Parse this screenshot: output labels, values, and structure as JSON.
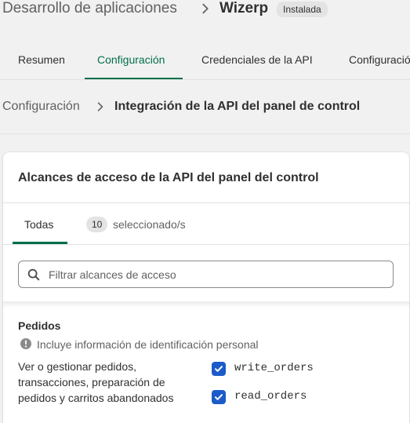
{
  "header": {
    "section": "Desarrollo de aplicaciones",
    "app_name": "Wizerp",
    "status_badge": "Instalada"
  },
  "tabs": [
    {
      "label": "Resumen",
      "active": false
    },
    {
      "label": "Configuración",
      "active": true
    },
    {
      "label": "Credenciales de la API",
      "active": false
    },
    {
      "label": "Configuración",
      "active": false
    }
  ],
  "sub_breadcrumb": {
    "parent": "Configuración",
    "current": "Integración de la API del panel de control"
  },
  "card": {
    "title": "Alcances de acceso de la API del panel del control",
    "tab_all": "Todas",
    "selected_count": "10",
    "selected_label": "seleccionado/s",
    "search_placeholder": "Filtrar alcances de acceso",
    "section": {
      "title": "Pedidos",
      "pii_notice": "Incluye información de identificación personal",
      "description": "Ver o gestionar pedidos, transacciones, preparación de pedidos y carritos abandonados",
      "scopes": [
        {
          "name": "write_orders",
          "checked": true
        },
        {
          "name": "read_orders",
          "checked": true
        }
      ]
    }
  },
  "colors": {
    "accent": "#00704a",
    "checkbox": "#1c5bc9",
    "background": "#f1f1f1"
  }
}
